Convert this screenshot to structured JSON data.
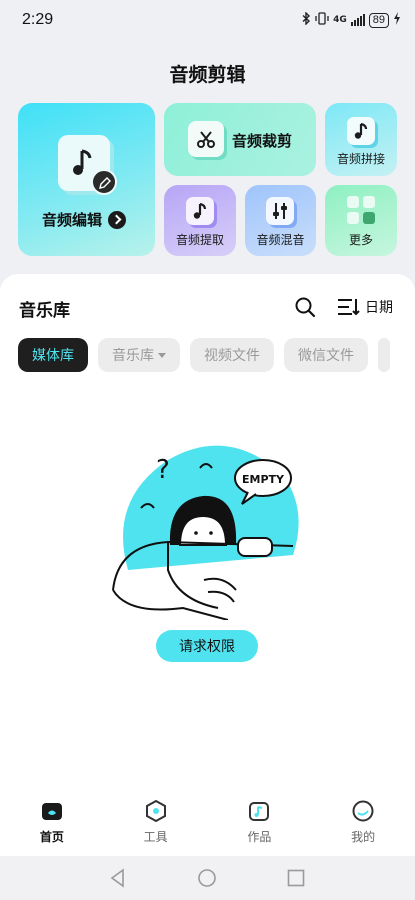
{
  "status": {
    "time": "2:29",
    "network": "4G",
    "battery": "89"
  },
  "header": {
    "title": "音频剪辑"
  },
  "tools": {
    "edit": "音频编辑",
    "cut": "音频裁剪",
    "join": "音频拼接",
    "extract": "音频提取",
    "mix": "音频混音",
    "more": "更多"
  },
  "library": {
    "title": "音乐库",
    "sort_label": "日期",
    "tabs": [
      {
        "label": "媒体库",
        "active": true
      },
      {
        "label": "音乐库",
        "active": false
      },
      {
        "label": "视频文件",
        "active": false
      },
      {
        "label": "微信文件",
        "active": false
      }
    ],
    "empty_text": "EMPTY",
    "permission_button": "请求权限"
  },
  "nav": {
    "items": [
      {
        "label": "首页",
        "icon": "home-icon",
        "active": true
      },
      {
        "label": "工具",
        "icon": "tools-icon",
        "active": false
      },
      {
        "label": "作品",
        "icon": "works-icon",
        "active": false
      },
      {
        "label": "我的",
        "icon": "profile-icon",
        "active": false
      }
    ]
  },
  "colors": {
    "accent": "#4fe3ef",
    "active_tab_bg": "#1f1f1f"
  }
}
